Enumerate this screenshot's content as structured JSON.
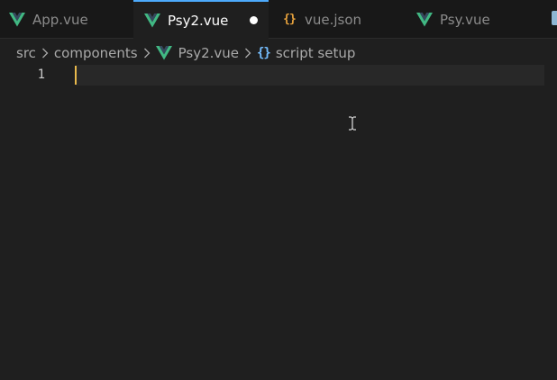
{
  "tabs": [
    {
      "label": "App.vue",
      "icon": "vue-icon",
      "active": false
    },
    {
      "label": "Psy2.vue",
      "icon": "vue-icon",
      "active": true,
      "dirty": true
    },
    {
      "label": "vue.json",
      "icon": "json-braces-icon",
      "active": false,
      "icon_text": "{}"
    },
    {
      "label": "Psy.vue",
      "icon": "vue-icon",
      "active": false
    }
  ],
  "breadcrumb": {
    "items": [
      "src",
      "components",
      "Psy2.vue",
      "script setup"
    ],
    "symbol_icon_text": "{}"
  },
  "editor": {
    "line_numbers": [
      "1"
    ],
    "content": ""
  },
  "colors": {
    "vue_green": "#41b883",
    "vue_dark": "#35495e",
    "json_orange": "#e8a33d",
    "active_tab_border": "#4daafc",
    "caret": "#e8b94c"
  }
}
